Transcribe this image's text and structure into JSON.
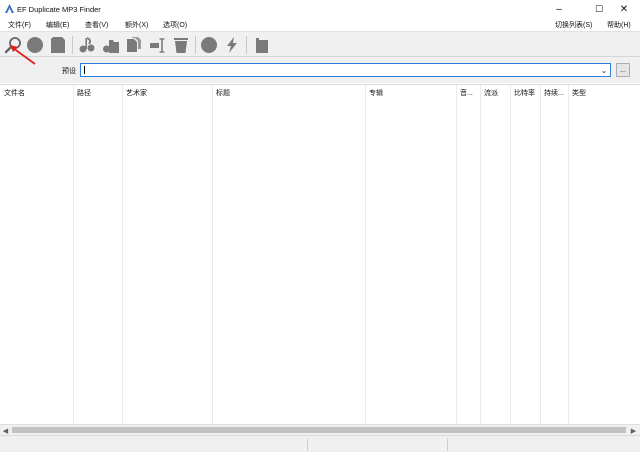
{
  "window": {
    "title": "EF Duplicate MP3 Finder",
    "minimize": "–",
    "maximize": "☐",
    "close": "✕"
  },
  "menu": {
    "left": [
      "文件(F)",
      "编辑(E)",
      "查看(V)",
      "额外(X)",
      "选项(O)"
    ],
    "right": [
      "切换列表(S)",
      "帮助(H)"
    ]
  },
  "toolbar": {
    "icons": [
      "search-icon",
      "circle-icon",
      "page-icon",
      "music-notes-icon",
      "folder-music-icon",
      "copy-pages-icon",
      "rename-icon",
      "trash-icon",
      "stop-icon",
      "flash-icon",
      "bookmark-icon"
    ]
  },
  "preset": {
    "label": "预设",
    "value": "",
    "browse_label": "..."
  },
  "columns": [
    "文件名",
    "路径",
    "艺术家",
    "标题",
    "专辑",
    "音...",
    "流派",
    "比特率",
    "持续...",
    "类型"
  ],
  "colors": {
    "toolbar_icon": "#7a7a7a",
    "combo_border": "#2f7fd7",
    "annotation": "#e01f1f"
  }
}
